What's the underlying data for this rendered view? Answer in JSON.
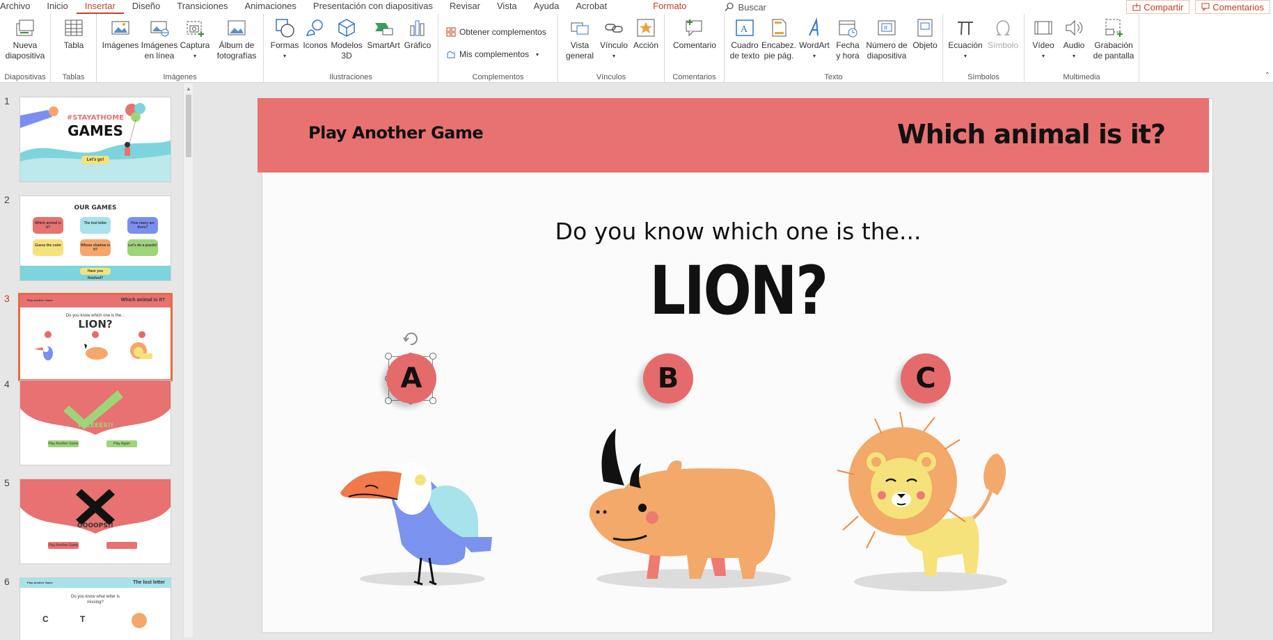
{
  "menu": {
    "tabs": [
      "Archivo",
      "Inicio",
      "Insertar",
      "Diseño",
      "Transiciones",
      "Animaciones",
      "Presentación con diapositivas",
      "Revisar",
      "Vista",
      "Ayuda",
      "Acrobat"
    ],
    "active_tab": "Insertar",
    "format_tab": "Formato",
    "search_placeholder": "Buscar",
    "share": "Compartir",
    "comments": "Comentarios"
  },
  "ribbon": {
    "groups": {
      "diapositivas": "Diapositivas",
      "tablas": "Tablas",
      "imagenes": "Imágenes",
      "ilustraciones": "Ilustraciones",
      "complementos": "Complementos",
      "vinculos": "Vínculos",
      "comentarios": "Comentarios",
      "texto": "Texto",
      "simbolos": "Símbolos",
      "multimedia": "Multimedia"
    },
    "buttons": {
      "nueva_l1": "Nueva",
      "nueva_l2": "diapositiva",
      "tabla": "Tabla",
      "imagenes": "Imágenes",
      "imagenes_linea_l1": "Imágenes",
      "imagenes_linea_l2": "en línea",
      "captura": "Captura",
      "album_l1": "Álbum de",
      "album_l2": "fotografías",
      "formas": "Formas",
      "iconos": "Iconos",
      "modelos_l1": "Modelos",
      "modelos_l2": "3D",
      "smartart": "SmartArt",
      "grafico": "Gráfico",
      "obtener": "Obtener complementos",
      "mis": "Mis complementos",
      "vista_l1": "Vista",
      "vista_l2": "general",
      "vinculo": "Vínculo",
      "accion": "Acción",
      "comentario": "Comentario",
      "cuadro_l1": "Cuadro",
      "cuadro_l2": "de texto",
      "encab_l1": "Encabez.",
      "encab_l2": "pie pág.",
      "wordart": "WordArt",
      "fecha_l1": "Fecha",
      "fecha_l2": "y hora",
      "numero_l1": "Número de",
      "numero_l2": "diapositiva",
      "objeto": "Objeto",
      "ecuacion": "Ecuación",
      "simbolo": "Símbolo",
      "video": "Vídeo",
      "audio": "Audio",
      "grabacion_l1": "Grabación",
      "grabacion_l2": "de pantalla"
    }
  },
  "thumbnails": {
    "numbers": [
      "1",
      "2",
      "3",
      "4",
      "5",
      "6"
    ],
    "current": 3,
    "t1": {
      "tag": "#STAYATHOME",
      "title": "GAMES",
      "button": "Let's go!"
    },
    "t2": {
      "title": "OUR GAMES",
      "items": [
        "Which animal is it?",
        "The lost letter",
        "How many are there?",
        "Guess the color",
        "Whose shadow is it?",
        "Let's do a puzzle!"
      ],
      "footer": "Have you finished?"
    },
    "t3": {
      "left": "Play Another Game",
      "right": "Which animal is it?",
      "q": "Do you know which one is the...",
      "a": "LION?"
    },
    "t4": {
      "text": "YEEEEES!!",
      "b1": "Play Another Game",
      "b2": "Play Again"
    },
    "t5": {
      "text": "OOOOPS!!",
      "b1": "Play Another Game"
    },
    "t6": {
      "left": "Play Another Game",
      "right": "The lost letter",
      "q1": "Do you know what letter is",
      "q2": "missing?",
      "l1": "C",
      "l2": "T"
    }
  },
  "slide": {
    "banner_left": "Play Another Game",
    "banner_right": "Which animal is it?",
    "question": "Do you know which one is the...",
    "answer": "LION?",
    "choices": [
      "A",
      "B",
      "C"
    ]
  },
  "colors": {
    "accent": "#b7472a",
    "banner": "#e87172",
    "choice": "#e46a6c"
  }
}
